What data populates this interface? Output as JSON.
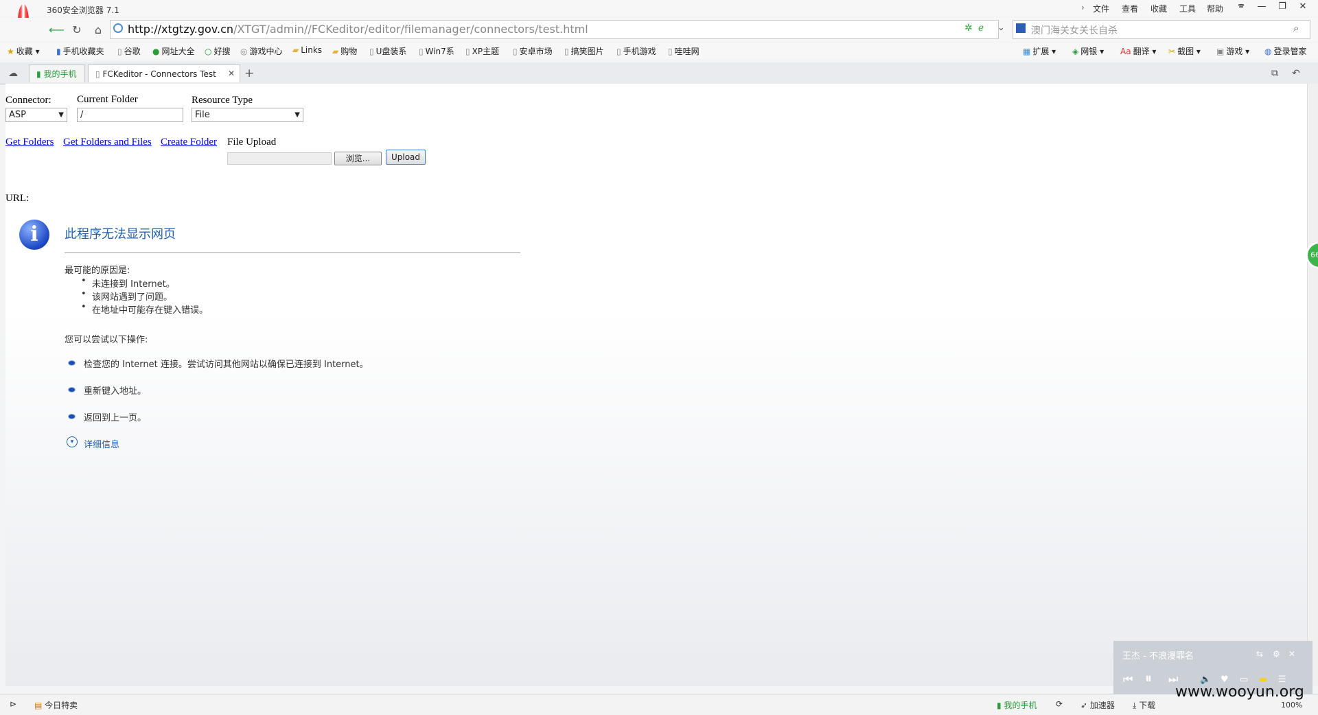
{
  "app": {
    "title": "360安全浏览器 7.1",
    "menu": [
      "文件",
      "查看",
      "收藏",
      "工具",
      "帮助"
    ],
    "window_controls": [
      "🕿",
      "—",
      "❐",
      "✕"
    ]
  },
  "address": {
    "url_host": "http://xtgtzy.gov.cn",
    "url_path": "/XTGT/admin//FCKeditor/editor/filemanager/connectors/test.html",
    "search_placeholder": "澳门海关女关长自杀"
  },
  "bookmarks": [
    "收藏",
    "手机收藏夹",
    "谷歌",
    "网址大全",
    "好搜",
    "游戏中心",
    "Links",
    "购物",
    "U盘装系",
    "Win7系",
    "XP主题",
    "安卓市场",
    "搞笑图片",
    "手机游戏",
    "哇哇网"
  ],
  "toolbar_right": [
    "扩展",
    "网银",
    "翻译",
    "截图",
    "游戏",
    "登录管家"
  ],
  "tabs": [
    {
      "label": "我的手机"
    },
    {
      "label": "FCKeditor - Connectors Test"
    }
  ],
  "form": {
    "connector_label": "Connector:",
    "connector_value": "ASP",
    "folder_label": "Current Folder",
    "folder_value": "/",
    "resource_label": "Resource Type",
    "resource_value": "File",
    "links": [
      "Get Folders",
      "Get Folders and Files",
      "Create Folder"
    ],
    "upload_label": "File Upload",
    "browse_label": "浏览...",
    "upload_button": "Upload",
    "url_label": "URL:"
  },
  "error": {
    "title": "此程序无法显示网页",
    "reasons_heading": "最可能的原因是:",
    "reasons": [
      "未连接到 Internet。",
      "该网站遇到了问题。",
      "在地址中可能存在键入错误。"
    ],
    "actions_heading": "您可以尝试以下操作:",
    "actions": [
      "检查您的 Internet 连接。尝试访问其他网站以确保已连接到 Internet。",
      "重新键入地址。",
      "返回到上一页。"
    ],
    "details": "详细信息"
  },
  "side_badge": "66",
  "status": {
    "left": "今日特卖",
    "right": [
      "我的手机",
      "加速器",
      "下载",
      "100%"
    ]
  },
  "player": {
    "song": "王杰 - 不浪漫罪名"
  },
  "watermark": "www.wooyun.org",
  "colors": {
    "link": "#0000ee",
    "error_title": "#1f5fb4",
    "accent_green": "#3cb54a"
  }
}
